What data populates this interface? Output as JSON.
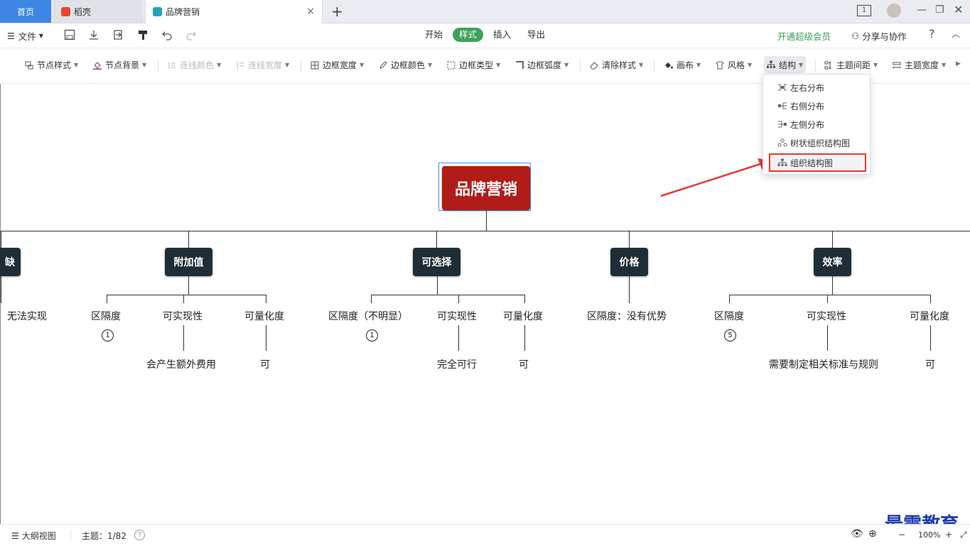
{
  "tabs": {
    "home": "首页",
    "daoke": "稻壳",
    "brand": "品牌营销",
    "add": "+",
    "close": "×"
  },
  "window": {
    "page_badge": "1"
  },
  "toolbar1": {
    "file": "文件",
    "menu_tabs": [
      "开始",
      "样式",
      "插入",
      "导出"
    ],
    "vip": "开通超级会员",
    "share": "分享与协作",
    "help": "?"
  },
  "toolbar2": {
    "node_style": "节点样式",
    "node_bg": "节点背景",
    "line_color": "连线颜色",
    "line_width": "连线宽度",
    "border_width": "边框宽度",
    "border_color": "边框颜色",
    "border_type": "边框类型",
    "border_radius": "边框弧度",
    "clear_style": "清除样式",
    "canvas": "画布",
    "theme_style": "风格",
    "structure": "结构",
    "topic_spacing": "主题间距",
    "topic_width": "主题宽度"
  },
  "dropdown": {
    "items": [
      "左右分布",
      "右侧分布",
      "左侧分布",
      "树状组织结构图",
      "组织结构图"
    ],
    "highlighted": "组织结构图"
  },
  "mindmap": {
    "root": "品牌营销",
    "branches": [
      {
        "label": "缺",
        "children": [
          {
            "label": "无法实现"
          }
        ]
      },
      {
        "label": "附加值",
        "children": [
          {
            "label": "区隔度",
            "badge": "1"
          },
          {
            "label": "可实现性",
            "sub": "会产生额外费用"
          },
          {
            "label": "可量化度",
            "sub": "可"
          }
        ]
      },
      {
        "label": "可选择",
        "children": [
          {
            "label": "区隔度（不明显）",
            "badge": "1"
          },
          {
            "label": "可实现性",
            "sub": "完全可行"
          },
          {
            "label": "可量化度",
            "sub": "可"
          }
        ]
      },
      {
        "label": "价格",
        "children": [
          {
            "label": "区隔度：没有优势"
          }
        ]
      },
      {
        "label": "效率",
        "children": [
          {
            "label": "区隔度",
            "badge": "5"
          },
          {
            "label": "可实现性",
            "sub": "需要制定相关标准与规则"
          },
          {
            "label": "可量化度",
            "sub": "可"
          }
        ]
      }
    ]
  },
  "statusbar": {
    "outline": "大纲视图",
    "topic_count": "主题：1/82",
    "zoom": "100%"
  },
  "watermark": "最需教育",
  "colors": {
    "accent_green": "#3da05b",
    "home_tab": "#3d86e6",
    "root_node": "#b01c18",
    "branch_node": "#1f2e36",
    "highlight_red": "#e53935"
  }
}
